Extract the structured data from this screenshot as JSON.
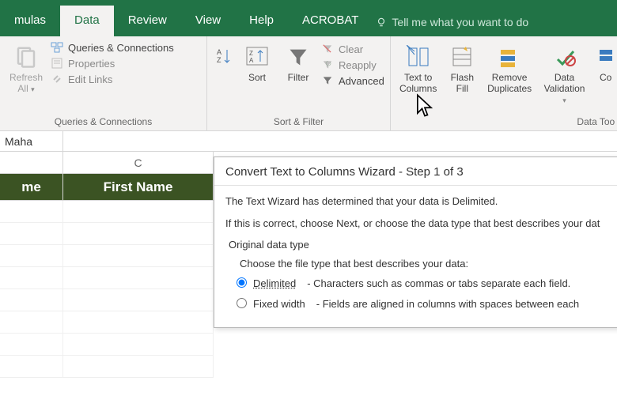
{
  "tabs": {
    "formulas": "mulas",
    "data": "Data",
    "review": "Review",
    "view": "View",
    "help": "Help",
    "acrobat": "ACROBAT"
  },
  "tellme": {
    "placeholder": "Tell me what you want to do"
  },
  "ribbon": {
    "refresh": {
      "line1": "Refresh",
      "line2": "All"
    },
    "queries": "Queries & Connections",
    "properties": "Properties",
    "editlinks": "Edit Links",
    "group1_label": "Queries & Connections",
    "sort": "Sort",
    "filter": "Filter",
    "clear": "Clear",
    "reapply": "Reapply",
    "advanced": "Advanced",
    "group2_label": "Sort & Filter",
    "texttocols": {
      "line1": "Text to",
      "line2": "Columns"
    },
    "flashfill": {
      "line1": "Flash",
      "line2": "Fill"
    },
    "removedup": {
      "line1": "Remove",
      "line2": "Duplicates"
    },
    "datavalid": {
      "line1": "Data",
      "line2": "Validation"
    },
    "cons": "Co",
    "group3_label": "Data Too"
  },
  "namebox": "Maha",
  "sheet": {
    "colC": "C",
    "hdrB": "me",
    "hdrC": "First Name"
  },
  "dialog": {
    "title": "Convert Text to Columns Wizard - Step 1 of 3",
    "line1": "The Text Wizard has determined that your data is Delimited.",
    "line2": "If this is correct, choose Next, or choose the data type that best describes your dat",
    "group_label": "Original data type",
    "choose": "Choose the file type that best describes your data:",
    "opt1_label": "Delimited",
    "opt1_desc": "- Characters such as commas or tabs separate each field.",
    "opt2_label": "Fixed width",
    "opt2_desc": "- Fields are aligned in columns with spaces between each"
  }
}
